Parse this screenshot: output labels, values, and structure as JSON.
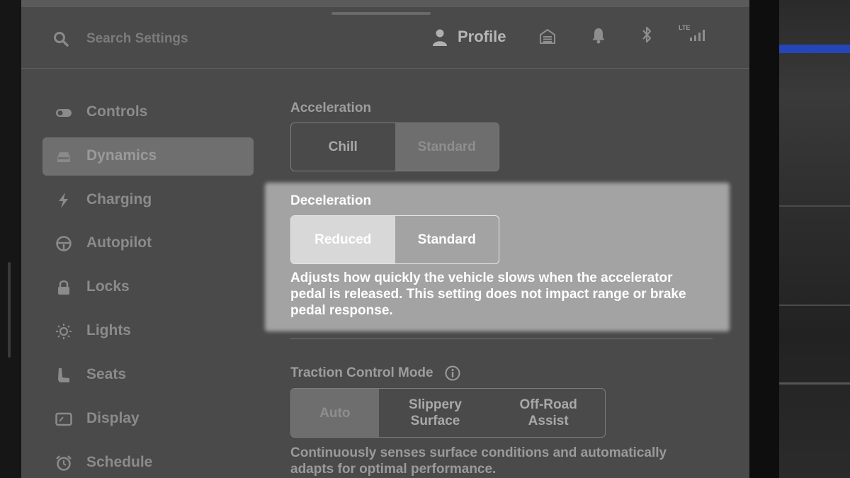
{
  "topbar": {
    "search_placeholder": "Search Settings",
    "profile_label": "Profile",
    "network_label": "LTE"
  },
  "sidebar": {
    "items": [
      {
        "label": "Controls",
        "icon": "toggle-icon",
        "active": false
      },
      {
        "label": "Dynamics",
        "icon": "car-icon",
        "active": true
      },
      {
        "label": "Charging",
        "icon": "bolt-icon",
        "active": false
      },
      {
        "label": "Autopilot",
        "icon": "steering-wheel-icon",
        "active": false
      },
      {
        "label": "Locks",
        "icon": "lock-icon",
        "active": false
      },
      {
        "label": "Lights",
        "icon": "sun-icon",
        "active": false
      },
      {
        "label": "Seats",
        "icon": "seat-icon",
        "active": false
      },
      {
        "label": "Display",
        "icon": "display-icon",
        "active": false
      },
      {
        "label": "Schedule",
        "icon": "alarm-clock-icon",
        "active": false
      }
    ]
  },
  "acceleration": {
    "title": "Acceleration",
    "options": [
      "Chill",
      "Standard"
    ],
    "selected": "Standard"
  },
  "deceleration": {
    "title": "Deceleration",
    "options": [
      "Reduced",
      "Standard"
    ],
    "selected": "Reduced",
    "description": "Adjusts how quickly the vehicle slows when the accelerator pedal is released. This setting does not impact range or brake pedal response."
  },
  "traction": {
    "title": "Traction Control Mode",
    "options": [
      "Auto",
      "Slippery Surface",
      "Off-Road Assist"
    ],
    "selected": "Auto",
    "description": "Continuously senses surface conditions and automatically adapts for optimal performance."
  },
  "colors": {
    "screen_bg": "#4a4a4a",
    "highlight_bg": "#a3a3a3",
    "selected_segment": "#6e6e6e",
    "highlight_selected": "#d8d8d8"
  }
}
